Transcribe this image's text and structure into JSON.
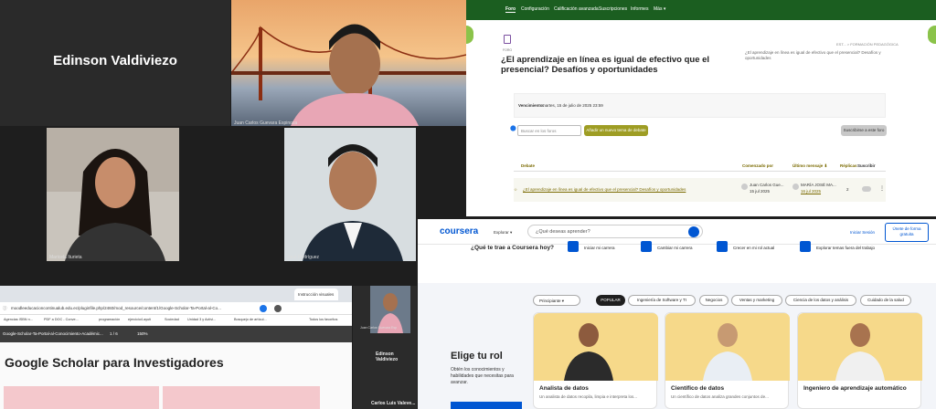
{
  "participants": {
    "edinson": "Edinson Valdiviezo",
    "juan_carlos": "Juan Carlos Guevara Espinoza",
    "maricela": "Maricela Iturieta",
    "jose": "José Rodríguez",
    "juan_carlos_small": "Juan Carlos Guevara Esp",
    "edinson_side": "Edinson Valdiviezo",
    "carlos_side": "Carlos Luis Valeve..."
  },
  "moodle": {
    "nav": [
      "Foro",
      "Configuración",
      "Calificación avanzada",
      "Suscripciones",
      "Informes",
      "Más ▾"
    ],
    "breadcrumb": "EST... > FORMACIÓN PEDAGÓGICA",
    "section_label": "FORO",
    "title": "¿El aprendizaje en línea es igual de efectivo que el presencial? Desafíos y oportunidades",
    "title_side": "¿El aprendizaje en línea es igual de efectivo que el presencial? Desafíos y oportunidades",
    "due_label": "Vencimiento:",
    "due_value": "martes, 15 de julio de 2025 23:59",
    "search_placeholder": "Buscar en los foros",
    "add_topic": "Añadir un nuevo tema de debate",
    "subscribe": "Suscribirse a este foro",
    "columns": [
      "Debate",
      "Comenzado por",
      "Último mensaje ⬇",
      "Réplicas",
      "Suscribir"
    ],
    "row": {
      "debate": "¿El aprendizaje en línea es igual de efectivo que el presencial? Desafíos y oportunidades",
      "started_by": "Juan Carlos Gue...",
      "started_date": "15 jul 2025",
      "last_by": "MARÍA JOSÉ MA...",
      "last_date": "16 jul 2025",
      "replies": "2"
    }
  },
  "coursera": {
    "logo": "coursera",
    "explore": "Explorar ▾",
    "search_placeholder": "¿Qué deseas aprender?",
    "login": "Iniciar Sesión",
    "join": "Únete de forma gratuita",
    "question": "¿Qué te trae a Coursera hoy?",
    "goals": [
      "Iniciar mi carrera",
      "Cambiar mi carrera",
      "Crecer en mi rol actual",
      "Explorar temas fuera del trabajo"
    ],
    "level_select": "Principiante ▾",
    "tags": [
      "POPULAR",
      "Ingeniería de Software y TI",
      "Negocios",
      "Ventas y marketing",
      "Ciencia de los datos y análisis",
      "Cuidado de la salud"
    ],
    "role_title": "Elige tu rol",
    "role_desc": "Obtén los conocimientos y habilidades que necesitas para avanzar.",
    "roles": [
      "Analista de datos",
      "Científico de datos",
      "Ingeniero de aprendizaje automático"
    ],
    "role_subs": [
      "Un analista de datos recopila, limpia e interpreta los...",
      "Un científico de datos analiza grandes conjuntos de...",
      ""
    ]
  },
  "browser": {
    "url": "moodleeducacioncontinualub.edu.ec/pluginfile.php/2460/mod_resource/content/1/Google-Scholar-Ta-Portal-al-Co...",
    "tab_title": "Instrucción visuales",
    "bookmarks": [
      "Agencias ISBN n...",
      "PDF a DOC - Conve...",
      "programación",
      "ejercicio4.ayuti",
      "Sociedad",
      "Unidad 3 y Activi...",
      "Bosquejo de artícul...",
      "Todos los favoritos"
    ],
    "pdf_title": "Google-Scholar-Ta-Portal-al-Conocimiento-Académic...",
    "page": "1 / 6",
    "zoom": "150%",
    "heading": "Google Scholar para Investigadores"
  },
  "colors": {
    "moodle_green": "#1b5e20",
    "coursera_blue": "#0056d2",
    "olive_button": "#9e9d24"
  }
}
